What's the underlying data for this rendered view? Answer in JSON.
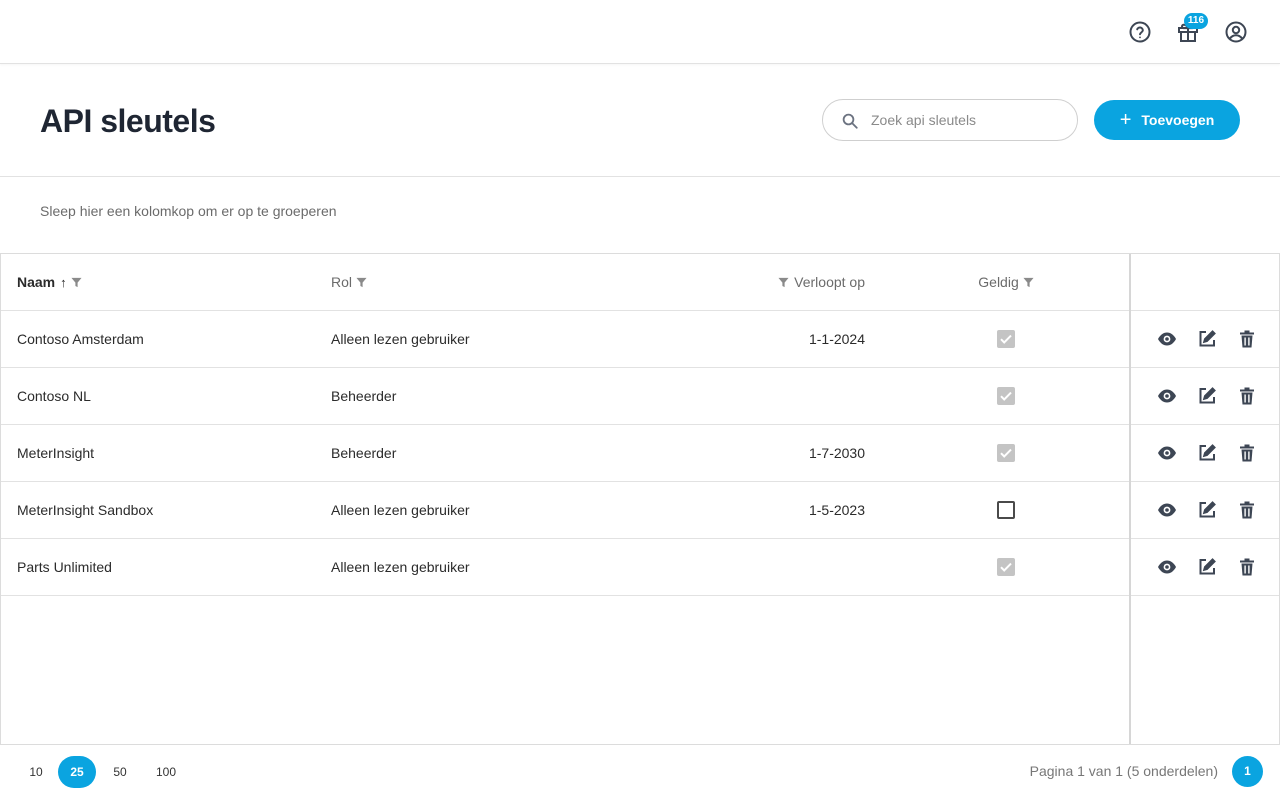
{
  "topbar": {
    "notifications_count": "116"
  },
  "page": {
    "title": "API sleutels",
    "search_placeholder": "Zoek api sleutels",
    "add_label": "Toevoegen",
    "group_hint": "Sleep hier een kolomkop om er op te groeperen"
  },
  "grid": {
    "columns": {
      "name": "Naam",
      "role": "Rol",
      "expires": "Verloopt op",
      "valid": "Geldig"
    },
    "sort": {
      "column": "name",
      "direction": "ascending"
    },
    "rows": [
      {
        "name": "Contoso Amsterdam",
        "role": "Alleen lezen gebruiker",
        "expires": "1-1-2024",
        "valid": true
      },
      {
        "name": "Contoso NL",
        "role": "Beheerder",
        "expires": "",
        "valid": true
      },
      {
        "name": "MeterInsight",
        "role": "Beheerder",
        "expires": "1-7-2030",
        "valid": true
      },
      {
        "name": "MeterInsight Sandbox",
        "role": "Alleen lezen gebruiker",
        "expires": "1-5-2023",
        "valid": false
      },
      {
        "name": "Parts Unlimited",
        "role": "Alleen lezen gebruiker",
        "expires": "",
        "valid": true
      }
    ]
  },
  "pager": {
    "sizes": [
      "10",
      "25",
      "50",
      "100"
    ],
    "selected_size": "25",
    "info": "Pagina 1 van 1 (5 onderdelen)",
    "current_page": "1"
  },
  "colors": {
    "accent": "#0aa4e0",
    "title": "#1f2633",
    "icon": "#3d4654"
  },
  "icons": {
    "help": "help-circle-icon",
    "gift": "gift-icon",
    "account": "user-circle-icon",
    "search": "search-icon",
    "filter": "filter-icon",
    "view": "eye-icon",
    "edit": "edit-icon",
    "delete": "trash-icon"
  }
}
